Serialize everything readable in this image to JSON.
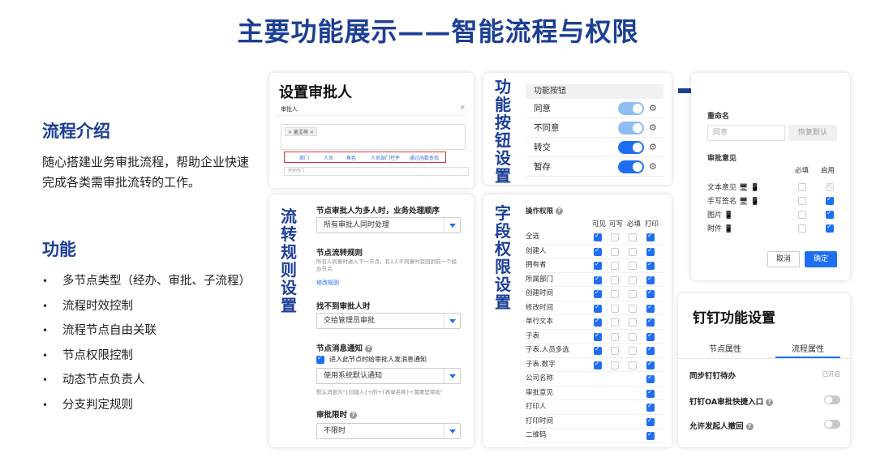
{
  "title": "主要功能展示——智能流程与权限",
  "intro": {
    "heading": "流程介绍",
    "text": "随心搭建业务审批流程，帮助企业快速完成各类需审批流转的工作。"
  },
  "features": {
    "heading": "功能",
    "items": [
      "多节点类型（经办、审批、子流程）",
      "流程时效控制",
      "流程节点自由关联",
      "节点权限控制",
      "动态节点负责人",
      "分支判定规则"
    ]
  },
  "approver_card": {
    "title": "设置审批人",
    "subtitle": "审批人",
    "close": "×",
    "tag": "× 童孟楠 ×",
    "tabs": [
      "部门",
      "人员",
      "角色",
      "人员部门控件",
      "通过函数查找"
    ],
    "search_placeholder": "搜索部门"
  },
  "buttons_card": {
    "vertical_title": [
      "功",
      "能",
      "按",
      "钮",
      "设",
      "置"
    ],
    "header": "功能按钮",
    "rows": [
      {
        "label": "同意",
        "state": "disabled-on"
      },
      {
        "label": "不同意",
        "state": "disabled-on"
      },
      {
        "label": "转交",
        "state": "on"
      },
      {
        "label": "暂存",
        "state": "on"
      }
    ],
    "gear_icon": "gear-icon",
    "toggle_colors": {
      "on": "#1e6ff0",
      "disabled_on": "#8fbcf3"
    }
  },
  "rename_card": {
    "label": "重命名",
    "placeholder": "同意",
    "reset_label": "恢复默认",
    "opinion_label": "审批意见",
    "col_required": "必填",
    "col_enabled": "启用",
    "rows": [
      {
        "label": "文本意见 🖥 📱",
        "required": false,
        "enabled": "disabled"
      },
      {
        "label": "手写签名 🖥 📱",
        "required": false,
        "enabled": true
      },
      {
        "label": "图片 📱",
        "required": false,
        "enabled": true
      },
      {
        "label": "附件 📱",
        "required": false,
        "enabled": true
      }
    ],
    "cancel_label": "取消",
    "ok_label": "确定"
  },
  "flow_card": {
    "vertical_title": [
      "流",
      "转",
      "规",
      "则",
      "设",
      "置"
    ],
    "order_label": "节点审批人为多人时，业务处理顺序",
    "order_value": "所有审批人同时处理",
    "rule_label": "节点流转规则",
    "rule_desc": "所有人同意时进入下一节点，有1人不同意时驳回到前一个经办节点",
    "rule_link": "修改规则",
    "notfound_label": "找不到审批人时",
    "notfound_value": "交给管理员审批",
    "notify_label": "节点消息通知",
    "notify_check": "进入此节点时给审批人发消息通知",
    "notify_value": "使用系统默认通知",
    "notify_default": "默认消息为\"{创建人}+的+{表单名称}+需要您审批\"",
    "limit_label": "审批限时",
    "limit_value": "不限时"
  },
  "fields_card": {
    "vertical_title": [
      "字",
      "段",
      "权",
      "限",
      "设",
      "置"
    ],
    "header": "操作权限",
    "columns": [
      "可见",
      "可写",
      "必填",
      "打印"
    ],
    "rows": [
      {
        "name": "全选",
        "v": true,
        "w": false,
        "r": false,
        "p": true
      },
      {
        "name": "创建人",
        "v": true,
        "w": false,
        "r": false,
        "p": true
      },
      {
        "name": "拥有者",
        "v": true,
        "w": false,
        "r": false,
        "p": true
      },
      {
        "name": "所属部门",
        "v": true,
        "w": false,
        "r": false,
        "p": true
      },
      {
        "name": "创建时间",
        "v": true,
        "w": false,
        "r": false,
        "p": true
      },
      {
        "name": "修改时间",
        "v": true,
        "w": false,
        "r": false,
        "p": true
      },
      {
        "name": "单行文本",
        "v": true,
        "w": false,
        "r": false,
        "p": true
      },
      {
        "name": "子表",
        "v": true,
        "w": false,
        "r": false,
        "p": true
      },
      {
        "name": "子表.人员多选",
        "v": true,
        "w": false,
        "r": false,
        "p": true
      },
      {
        "name": "子表.数字",
        "v": true,
        "w": false,
        "r": false,
        "p": true
      },
      {
        "name": "公司名称",
        "v": null,
        "w": null,
        "r": null,
        "p": true
      },
      {
        "name": "审批意见",
        "v": null,
        "w": null,
        "r": null,
        "p": true
      },
      {
        "name": "打印人",
        "v": null,
        "w": null,
        "r": null,
        "p": true
      },
      {
        "name": "打印时间",
        "v": null,
        "w": null,
        "r": null,
        "p": true
      },
      {
        "name": "二维码",
        "v": null,
        "w": null,
        "r": null,
        "p": true
      }
    ]
  },
  "dingtalk_card": {
    "title": "钉钉功能设置",
    "tabs": [
      "节点属性",
      "流程属性"
    ],
    "rows": [
      {
        "label": "同步钉钉待办",
        "note": "已开启"
      },
      {
        "label": "钉钉OA审批快捷入口",
        "toggle": false
      },
      {
        "label": "允许发起人撤回",
        "toggle": false
      }
    ]
  }
}
